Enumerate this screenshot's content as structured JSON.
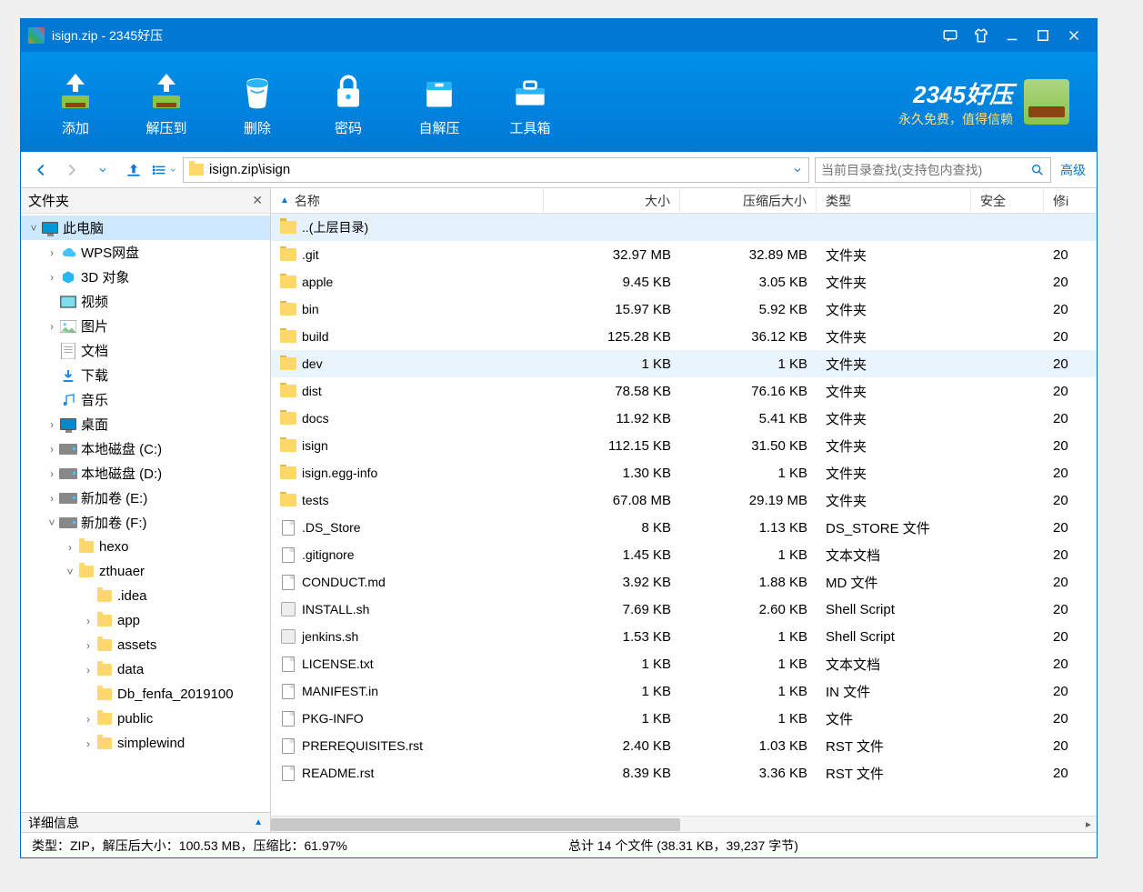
{
  "window": {
    "title": "isign.zip - 2345好压"
  },
  "title_controls": {
    "feedback": "feedback",
    "skin": "skin",
    "minimize": "min",
    "maximize": "max",
    "close": "close"
  },
  "toolbar": {
    "add": "添加",
    "extract": "解压到",
    "delete": "删除",
    "password": "密码",
    "sfx": "自解压",
    "tools": "工具箱"
  },
  "brand": {
    "line1": "2345好压",
    "line2": "永久免费，值得信赖"
  },
  "nav": {
    "path": "isign.zip\\isign",
    "search_placeholder": "当前目录查找(支持包内查找)",
    "advanced": "高级"
  },
  "sidebar": {
    "title": "文件夹",
    "items": [
      {
        "ind": 0,
        "tw": "˅",
        "icon": "monitor",
        "label": "此电脑",
        "sel": true
      },
      {
        "ind": 1,
        "tw": "›",
        "icon": "cloud",
        "label": "WPS网盘"
      },
      {
        "ind": 1,
        "tw": "›",
        "icon": "cube",
        "label": "3D 对象"
      },
      {
        "ind": 1,
        "tw": "",
        "icon": "video",
        "label": "视频"
      },
      {
        "ind": 1,
        "tw": "›",
        "icon": "pic",
        "label": "图片"
      },
      {
        "ind": 1,
        "tw": "",
        "icon": "doc",
        "label": "文档"
      },
      {
        "ind": 1,
        "tw": "",
        "icon": "down",
        "label": "下载"
      },
      {
        "ind": 1,
        "tw": "",
        "icon": "music",
        "label": "音乐"
      },
      {
        "ind": 1,
        "tw": "›",
        "icon": "desktop",
        "label": "桌面"
      },
      {
        "ind": 1,
        "tw": "›",
        "icon": "drive",
        "label": "本地磁盘 (C:)"
      },
      {
        "ind": 1,
        "tw": "›",
        "icon": "drive",
        "label": "本地磁盘 (D:)"
      },
      {
        "ind": 1,
        "tw": "›",
        "icon": "drive",
        "label": "新加卷 (E:)"
      },
      {
        "ind": 1,
        "tw": "˅",
        "icon": "drive",
        "label": "新加卷 (F:)"
      },
      {
        "ind": 2,
        "tw": "›",
        "icon": "folder",
        "label": "hexo"
      },
      {
        "ind": 2,
        "tw": "˅",
        "icon": "folder",
        "label": "zthuaer"
      },
      {
        "ind": 3,
        "tw": "",
        "icon": "folder",
        "label": ".idea"
      },
      {
        "ind": 3,
        "tw": "›",
        "icon": "folder",
        "label": "app"
      },
      {
        "ind": 3,
        "tw": "›",
        "icon": "folder",
        "label": "assets"
      },
      {
        "ind": 3,
        "tw": "›",
        "icon": "folder",
        "label": "data"
      },
      {
        "ind": 3,
        "tw": "",
        "icon": "folder",
        "label": "Db_fenfa_2019100"
      },
      {
        "ind": 3,
        "tw": "›",
        "icon": "folder",
        "label": "public"
      },
      {
        "ind": 3,
        "tw": "›",
        "icon": "folder",
        "label": "simplewind"
      }
    ],
    "detail": "详细信息"
  },
  "columns": {
    "name": "名称",
    "size": "大小",
    "csize": "压缩后大小",
    "type": "类型",
    "security": "安全",
    "modified": "修i"
  },
  "files": [
    {
      "icon": "folder",
      "name": "..(上层目录)",
      "size": "",
      "csize": "",
      "type": "",
      "mod": "",
      "parent": true
    },
    {
      "icon": "folder",
      "name": ".git",
      "size": "32.97 MB",
      "csize": "32.89 MB",
      "type": "文件夹",
      "mod": "20"
    },
    {
      "icon": "folder",
      "name": "apple",
      "size": "9.45 KB",
      "csize": "3.05 KB",
      "type": "文件夹",
      "mod": "20"
    },
    {
      "icon": "folder",
      "name": "bin",
      "size": "15.97 KB",
      "csize": "5.92 KB",
      "type": "文件夹",
      "mod": "20"
    },
    {
      "icon": "folder",
      "name": "build",
      "size": "125.28 KB",
      "csize": "36.12 KB",
      "type": "文件夹",
      "mod": "20"
    },
    {
      "icon": "folder",
      "name": "dev",
      "size": "1 KB",
      "csize": "1 KB",
      "type": "文件夹",
      "mod": "20",
      "hover": true
    },
    {
      "icon": "folder",
      "name": "dist",
      "size": "78.58 KB",
      "csize": "76.16 KB",
      "type": "文件夹",
      "mod": "20"
    },
    {
      "icon": "folder",
      "name": "docs",
      "size": "11.92 KB",
      "csize": "5.41 KB",
      "type": "文件夹",
      "mod": "20"
    },
    {
      "icon": "folder",
      "name": "isign",
      "size": "112.15 KB",
      "csize": "31.50 KB",
      "type": "文件夹",
      "mod": "20"
    },
    {
      "icon": "folder",
      "name": "isign.egg-info",
      "size": "1.30 KB",
      "csize": "1 KB",
      "type": "文件夹",
      "mod": "20"
    },
    {
      "icon": "folder",
      "name": "tests",
      "size": "67.08 MB",
      "csize": "29.19 MB",
      "type": "文件夹",
      "mod": "20"
    },
    {
      "icon": "file",
      "name": ".DS_Store",
      "size": "8 KB",
      "csize": "1.13 KB",
      "type": "DS_STORE 文件",
      "mod": "20"
    },
    {
      "icon": "file",
      "name": ".gitignore",
      "size": "1.45 KB",
      "csize": "1 KB",
      "type": "文本文档",
      "mod": "20"
    },
    {
      "icon": "file",
      "name": "CONDUCT.md",
      "size": "3.92 KB",
      "csize": "1.88 KB",
      "type": "MD 文件",
      "mod": "20"
    },
    {
      "icon": "sh",
      "name": "INSTALL.sh",
      "size": "7.69 KB",
      "csize": "2.60 KB",
      "type": "Shell Script",
      "mod": "20"
    },
    {
      "icon": "sh",
      "name": "jenkins.sh",
      "size": "1.53 KB",
      "csize": "1 KB",
      "type": "Shell Script",
      "mod": "20"
    },
    {
      "icon": "file",
      "name": "LICENSE.txt",
      "size": "1 KB",
      "csize": "1 KB",
      "type": "文本文档",
      "mod": "20"
    },
    {
      "icon": "file",
      "name": "MANIFEST.in",
      "size": "1 KB",
      "csize": "1 KB",
      "type": "IN 文件",
      "mod": "20"
    },
    {
      "icon": "file",
      "name": "PKG-INFO",
      "size": "1 KB",
      "csize": "1 KB",
      "type": "文件",
      "mod": "20"
    },
    {
      "icon": "file",
      "name": "PREREQUISITES.rst",
      "size": "2.40 KB",
      "csize": "1.03 KB",
      "type": "RST 文件",
      "mod": "20"
    },
    {
      "icon": "file",
      "name": "README.rst",
      "size": "8.39 KB",
      "csize": "3.36 KB",
      "type": "RST 文件",
      "mod": "20"
    }
  ],
  "status": {
    "left": "类型：ZIP，解压后大小：100.53 MB，压缩比：61.97%",
    "right": "总计 14 个文件 (38.31 KB，39,237 字节)"
  }
}
